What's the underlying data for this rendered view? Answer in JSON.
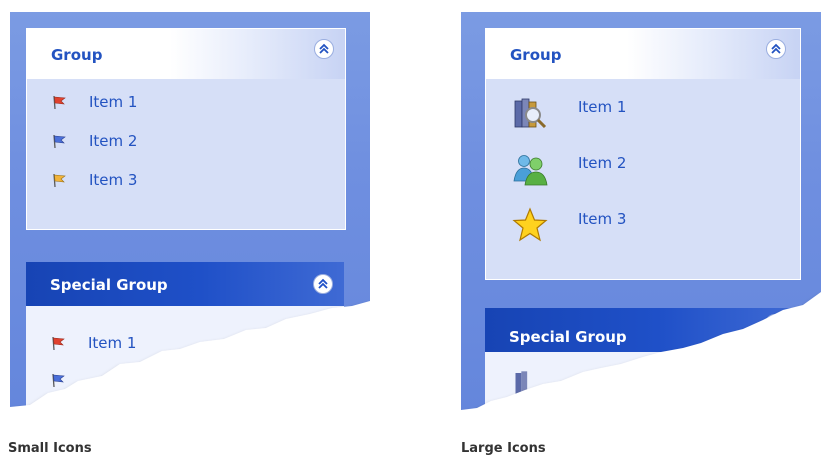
{
  "small": {
    "caption": "Small Icons",
    "group": {
      "title": "Group",
      "items": [
        {
          "label": "Item 1",
          "icon": "red-flag-icon",
          "color": "#e0412e"
        },
        {
          "label": "Item 2",
          "icon": "blue-flag-icon",
          "color": "#4a6fd9"
        },
        {
          "label": "Item 3",
          "icon": "yellow-flag-icon",
          "color": "#f2b33a"
        }
      ]
    },
    "special_group": {
      "title": "Special Group",
      "items": [
        {
          "label": "Item 1",
          "icon": "red-flag-icon",
          "color": "#e0412e"
        },
        {
          "label": "",
          "icon": "blue-flag-icon",
          "color": "#4a6fd9"
        }
      ]
    }
  },
  "large": {
    "caption": "Large Icons",
    "group": {
      "title": "Group",
      "items": [
        {
          "label": "Item 1",
          "icon": "books-search-icon"
        },
        {
          "label": "Item 2",
          "icon": "users-icon"
        },
        {
          "label": "Item 3",
          "icon": "star-icon"
        }
      ]
    },
    "special_group": {
      "title": "Special Group"
    }
  },
  "colors": {
    "pane": "#6f8fe0",
    "group_body": "#d6dff7",
    "title_text": "#2353c1",
    "special_header": "#1f50c8"
  }
}
